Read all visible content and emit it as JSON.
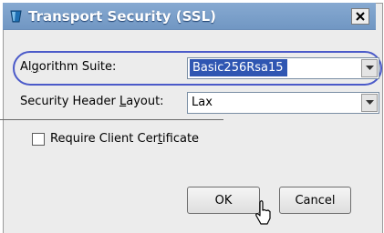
{
  "window": {
    "title": "Transport Security (SSL)",
    "title_icon": "cup-icon",
    "close_icon": "close-icon"
  },
  "form": {
    "algorithm_suite": {
      "label": "Algorithm Suite:",
      "mnemonic": "g",
      "value": "Basic256Rsa15"
    },
    "security_header_layout": {
      "label": "Security Header Layout:",
      "mnemonic": "L",
      "value": "Lax"
    },
    "require_client_certificate": {
      "label": "Require Client Certificate",
      "mnemonic": "t",
      "checked": false
    }
  },
  "buttons": {
    "ok": "OK",
    "cancel": "Cancel"
  },
  "colors": {
    "titlebar": "#7a9fc8",
    "selection": "#2f56b2",
    "highlight_ring": "#4b5ac9"
  }
}
